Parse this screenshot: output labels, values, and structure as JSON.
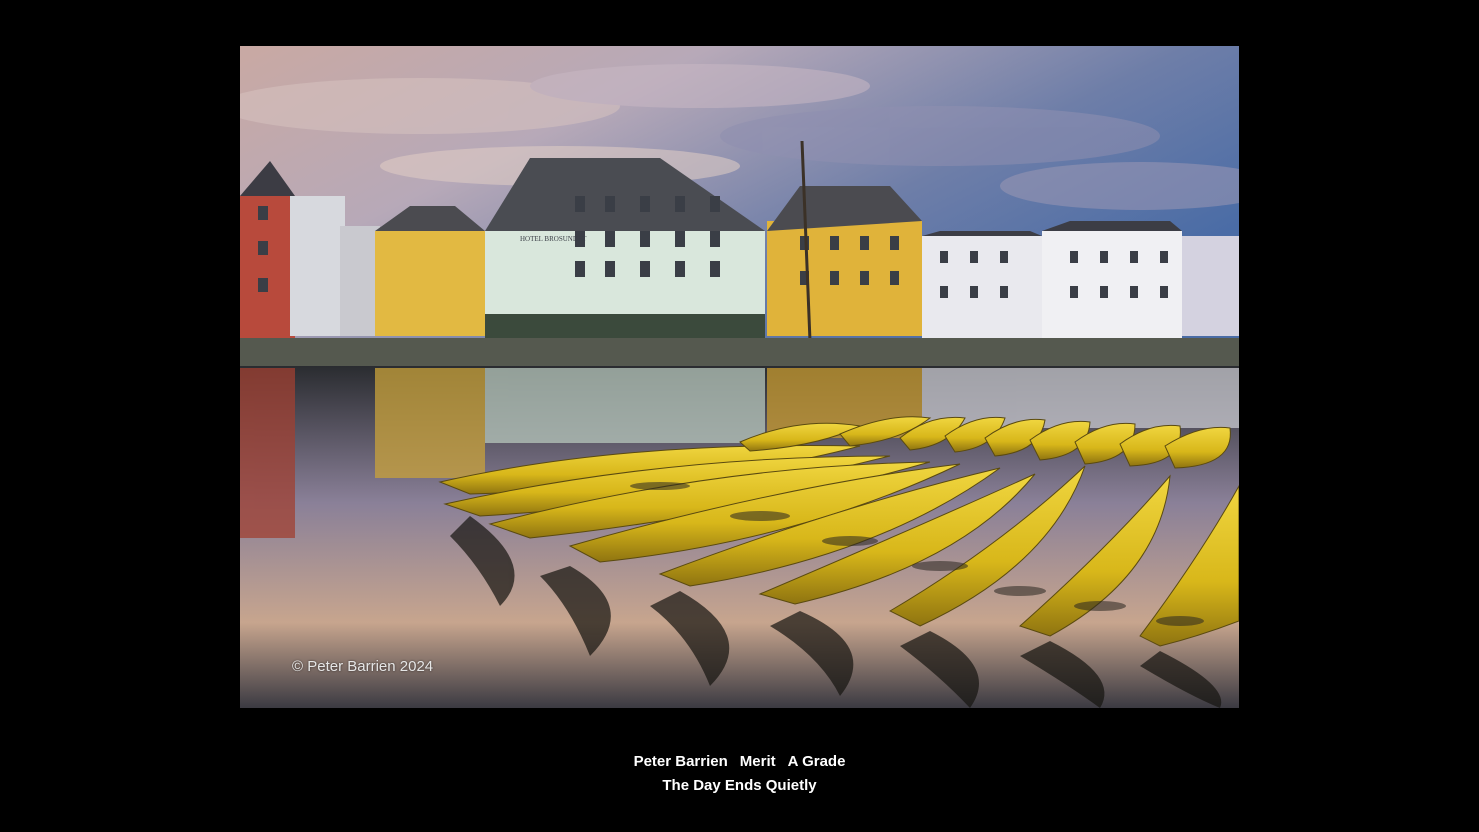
{
  "photo": {
    "copyright": "© Peter Barrien 2024",
    "hotel_sign": "HOTEL BROSUNDET",
    "colors": {
      "background": "#000000",
      "kayak": "#e2c21c",
      "sky_warm": "#d9b9a8",
      "sky_cool": "#4f6fa3"
    }
  },
  "caption": {
    "author": "Peter Barrien",
    "award": "Merit",
    "grade": "A Grade",
    "title": "The Day Ends Quietly"
  }
}
